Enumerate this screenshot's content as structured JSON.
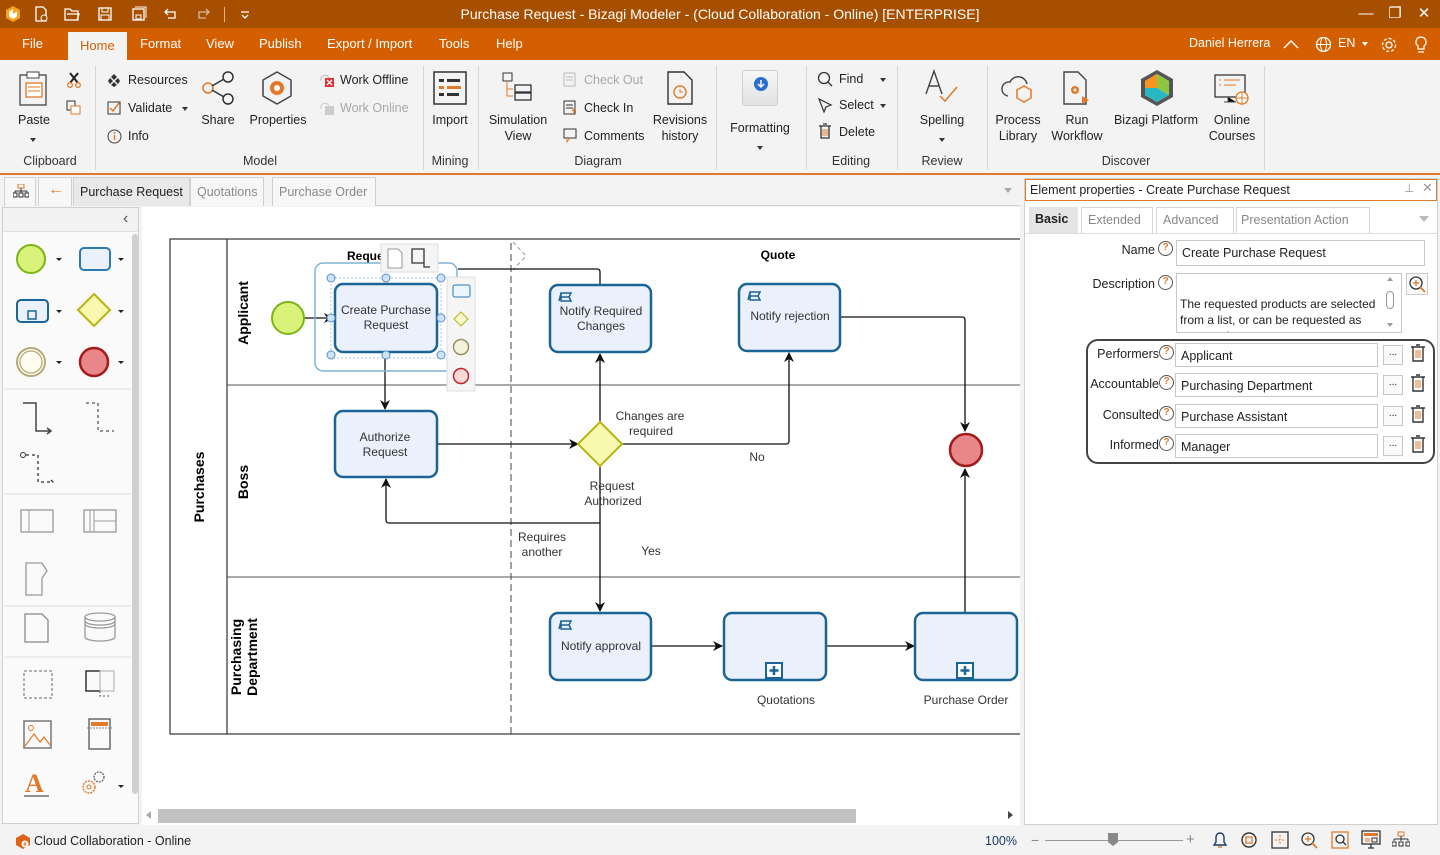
{
  "window": {
    "title": "Purchase Request - Bizagi Modeler - (Cloud Collaboration - Online) [ENTERPRISE]",
    "controls": {
      "minimize": "—",
      "restore": "❐",
      "close": "✕"
    }
  },
  "quick_access": [
    "app-logo-icon",
    "new-file-icon",
    "open-folder-icon",
    "save-icon",
    "save-all-icon",
    "undo-icon",
    "redo-icon",
    "customize-icon"
  ],
  "menu": {
    "items": [
      "File",
      "Home",
      "Format",
      "View",
      "Publish",
      "Export / Import",
      "Tools",
      "Help"
    ],
    "active": "Home",
    "user": "Daniel Herrera",
    "language": "EN"
  },
  "ribbon": {
    "clipboard": {
      "paste": "Paste",
      "group": "Clipboard"
    },
    "model": {
      "resources": "Resources",
      "validate": "Validate",
      "info": "Info",
      "share": "Share",
      "properties": "Properties",
      "work_offline": "Work Offline",
      "work_online": "Work Online",
      "group": "Model"
    },
    "mining": {
      "import": "Import",
      "group": "Mining"
    },
    "diagram": {
      "simulation_line1": "Simulation",
      "simulation_line2": "View",
      "check_out": "Check Out",
      "check_in": "Check In",
      "comments": "Comments",
      "revisions_line1": "Revisions",
      "revisions_line2": "history",
      "group": "Diagram"
    },
    "formatting": {
      "label": "Formatting"
    },
    "editing": {
      "find": "Find",
      "select": "Select",
      "delete": "Delete",
      "group": "Editing"
    },
    "review": {
      "spelling": "Spelling",
      "group": "Review"
    },
    "discover": {
      "process_line1": "Process",
      "process_line2": "Library",
      "run_line1": "Run",
      "run_line2": "Workflow",
      "bizagi_platform": "Bizagi Platform",
      "courses_line1": "Online",
      "courses_line2": "Courses",
      "group": "Discover"
    }
  },
  "doc_tabs": [
    {
      "label": "Purchase Request",
      "active": true
    },
    {
      "label": "Quotations",
      "active": false
    },
    {
      "label": "Purchase Order",
      "active": false
    }
  ],
  "diagram": {
    "pool": "Purchases",
    "lanes": [
      "Applicant",
      "Boss",
      "Purchasing\nDepartment"
    ],
    "lane_line1": "Purchasing",
    "lane_line2": "Department",
    "phases": [
      "Request",
      "Quote"
    ],
    "phase_request_visible": "Reque",
    "tasks": {
      "create_line1": "Create Purchase",
      "create_line2": "Request",
      "authorize_line1": "Authorize",
      "authorize_line2": "Request",
      "notify_changes_line1": "Notify Required",
      "notify_changes_line2": "Changes",
      "notify_rejection": "Notify rejection",
      "notify_approval": "Notify approval",
      "quotations": "Quotations",
      "purchase_order": "Purchase Order"
    },
    "labels": {
      "changes_line1": "Changes are",
      "changes_line2": "required",
      "no": "No",
      "authorized_line1": "Request",
      "authorized_line2": "Authorized",
      "requires_line1": "Requires",
      "requires_line2": "another",
      "yes": "Yes"
    },
    "colors": {
      "task_fill": "#eaf0fc",
      "task_stroke": "#1a6496",
      "start": "#d8f27a",
      "end": "#e8868a",
      "gateway": "#f8f8b0"
    }
  },
  "properties_panel": {
    "title": "Element properties - Create Purchase Request",
    "tabs": [
      "Basic",
      "Extended",
      "Advanced",
      "Presentation Action"
    ],
    "active_tab": "Basic",
    "name_label": "Name",
    "name_value": "Create Purchase Request",
    "description_label": "Description",
    "description_value": "The requested products are selected from a list, or can be requested as new products",
    "raci": [
      {
        "label": "Performers",
        "value": "Applicant"
      },
      {
        "label": "Accountable",
        "value": "Purchasing Department"
      },
      {
        "label": "Consulted",
        "value": "Purchase Assistant"
      },
      {
        "label": "Informed",
        "value": "Manager"
      }
    ],
    "help_glyph": "?",
    "browse_glyph": "..."
  },
  "status": {
    "connection": "Cloud Collaboration - Online",
    "zoom": "100%",
    "zoom_level_percent": 100
  },
  "accent": "#d35f00"
}
